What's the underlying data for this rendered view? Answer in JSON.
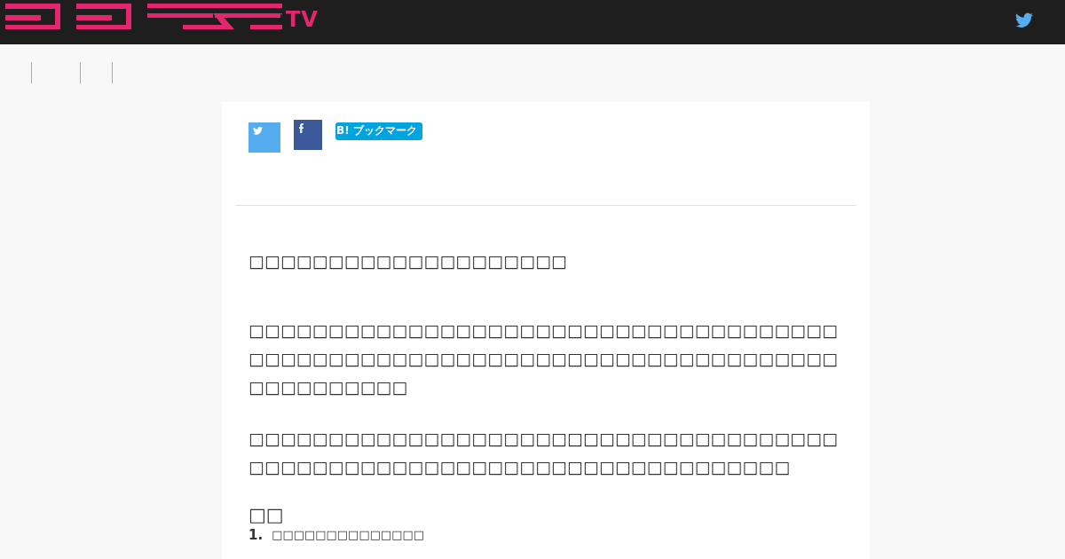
{
  "header": {
    "logo_suffix": "TV"
  },
  "share": [
    {
      "kind": "twitter"
    },
    {
      "kind": "facebook"
    },
    {
      "kind": "hatena",
      "label": "B! ブックマーク"
    }
  ],
  "article": {
    "blocks": [
      {
        "kind": "paragraph",
        "text": "□□□□□□□□□□□□□□□□□□□□"
      },
      {
        "kind": "paragraph",
        "text": "□□□□□□□□□□□□□□□□□□□□□□□□□□□□□□□□□□□□□□□□□□□□□□□□□□□□□□□□□□□□□□□□□□□□□□□□□□□□□□□□□□□□"
      },
      {
        "kind": "paragraph",
        "text": "□□□□□□□□□□□□□□□□□□□□□□□□□□□□□□□□□□□□□□□□□□□□□□□□□□□□□□□□□□□□□□□□□□□□□□□"
      },
      {
        "kind": "heading",
        "text": "□□"
      },
      {
        "kind": "list_item",
        "number": "1.",
        "text": "□□□□□□□□□□□□□□"
      }
    ]
  }
}
